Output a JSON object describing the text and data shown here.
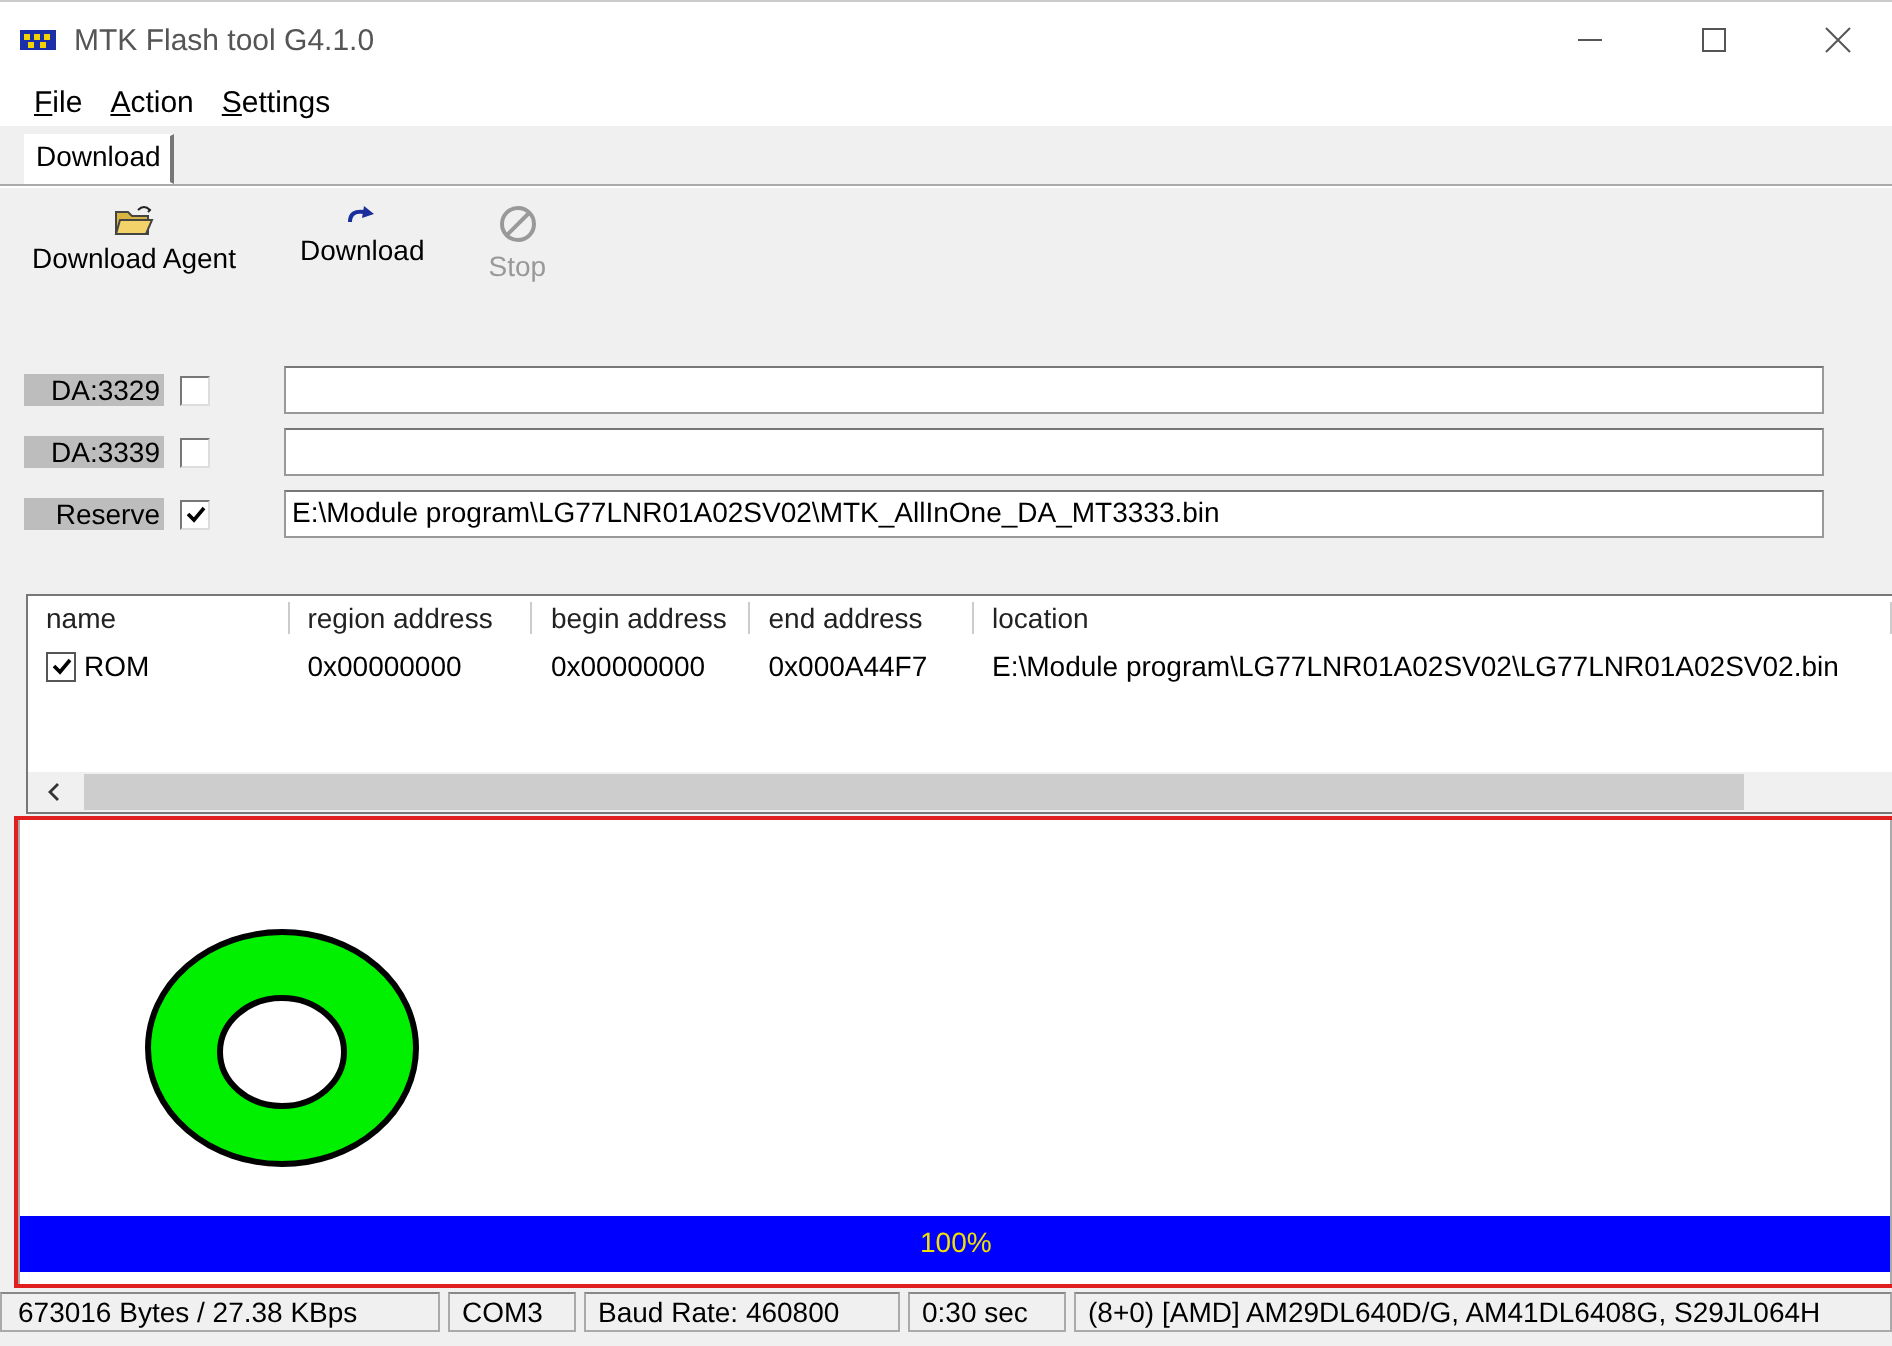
{
  "window": {
    "title": "MTK Flash tool G4.1.0"
  },
  "menu": [
    "File",
    "Action",
    "Settings"
  ],
  "tabs": [
    {
      "label": "Download",
      "selected": true
    }
  ],
  "toolbar": [
    {
      "label": "Download Agent",
      "kind": "folder",
      "disabled": false
    },
    {
      "label": "Download",
      "kind": "download",
      "disabled": false
    },
    {
      "label": "Stop",
      "kind": "stop",
      "disabled": true
    }
  ],
  "da_rows": [
    {
      "label": "DA:3329",
      "checked": false,
      "value": ""
    },
    {
      "label": "DA:3339",
      "checked": false,
      "value": ""
    },
    {
      "label": "Reserve",
      "checked": true,
      "value": "E:\\Module program\\LG77LNR01A02SV02\\MTK_AllInOne_DA_MT3333.bin"
    }
  ],
  "table": {
    "columns": [
      "name",
      "region address",
      "begin address",
      "end address",
      "location"
    ],
    "rows": [
      {
        "checked": true,
        "cells": [
          "ROM",
          "0x00000000",
          "0x00000000",
          "0x000A44F7",
          "E:\\Module program\\LG77LNR01A02SV02\\LG77LNR01A02SV02.bin"
        ]
      }
    ]
  },
  "progress": {
    "level": 1,
    "label": "100%"
  },
  "status_bar": [
    "673016 Bytes / 27.38 KBps",
    "COM3",
    "Baud Rate: 460800",
    "0:30 sec",
    "(8+0) [AMD] AM29DL640D/G, AM41DL6408G, S29JL064H"
  ]
}
